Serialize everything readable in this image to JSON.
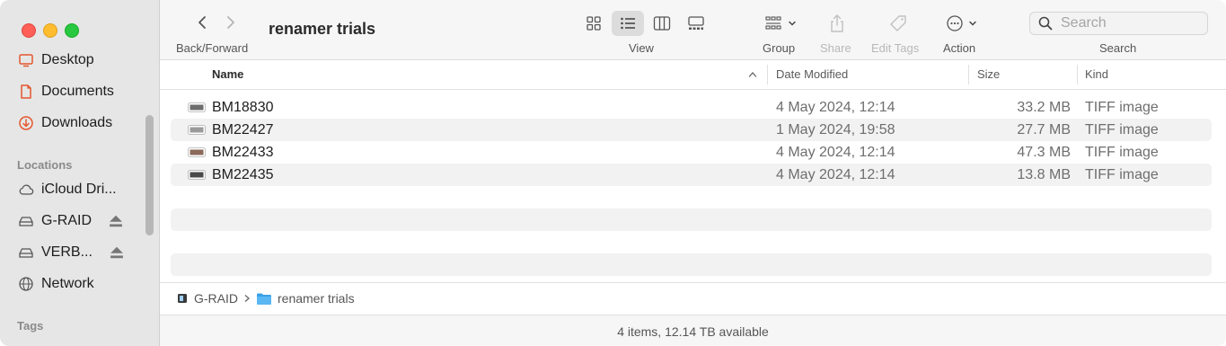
{
  "window": {
    "title": "renamer trials"
  },
  "sidebar": {
    "favorites": [
      {
        "label": "Desktop",
        "icon": "desktop-icon"
      },
      {
        "label": "Documents",
        "icon": "document-icon"
      },
      {
        "label": "Downloads",
        "icon": "download-icon"
      }
    ],
    "locations_header": "Locations",
    "locations": [
      {
        "label": "iCloud Dri...",
        "icon": "cloud-icon"
      },
      {
        "label": "G-RAID",
        "icon": "drive-icon",
        "eject": true
      },
      {
        "label": "VERB...",
        "icon": "drive-icon",
        "eject": true
      },
      {
        "label": "Network",
        "icon": "globe-icon"
      }
    ],
    "tags_header": "Tags",
    "colors": {
      "accent": "#e4572e"
    }
  },
  "toolbar": {
    "back_forward_label": "Back/Forward",
    "view_label": "View",
    "group_label": "Group",
    "share_label": "Share",
    "edit_tags_label": "Edit Tags",
    "action_label": "Action",
    "search_label": "Search",
    "search_placeholder": "Search",
    "active_view": "list"
  },
  "columns": {
    "name": "Name",
    "date": "Date Modified",
    "size": "Size",
    "kind": "Kind",
    "sort": "name-ascending"
  },
  "files": [
    {
      "name": "BM18830",
      "date": "4 May 2024, 12:14",
      "size": "33.2 MB",
      "kind": "TIFF image",
      "thumb": "#6d6d6d"
    },
    {
      "name": "BM22427",
      "date": "1 May 2024, 19:58",
      "size": "27.7 MB",
      "kind": "TIFF image",
      "thumb": "#9a9a9a"
    },
    {
      "name": "BM22433",
      "date": "4 May 2024, 12:14",
      "size": "47.3 MB",
      "kind": "TIFF image",
      "thumb": "#8a6a5a"
    },
    {
      "name": "BM22435",
      "date": "4 May 2024, 12:14",
      "size": "13.8 MB",
      "kind": "TIFF image",
      "thumb": "#4a4a4a"
    }
  ],
  "pathbar": {
    "drive": "G-RAID",
    "folder": "renamer trials"
  },
  "status": {
    "text": "4 items, 12.14 TB available"
  }
}
